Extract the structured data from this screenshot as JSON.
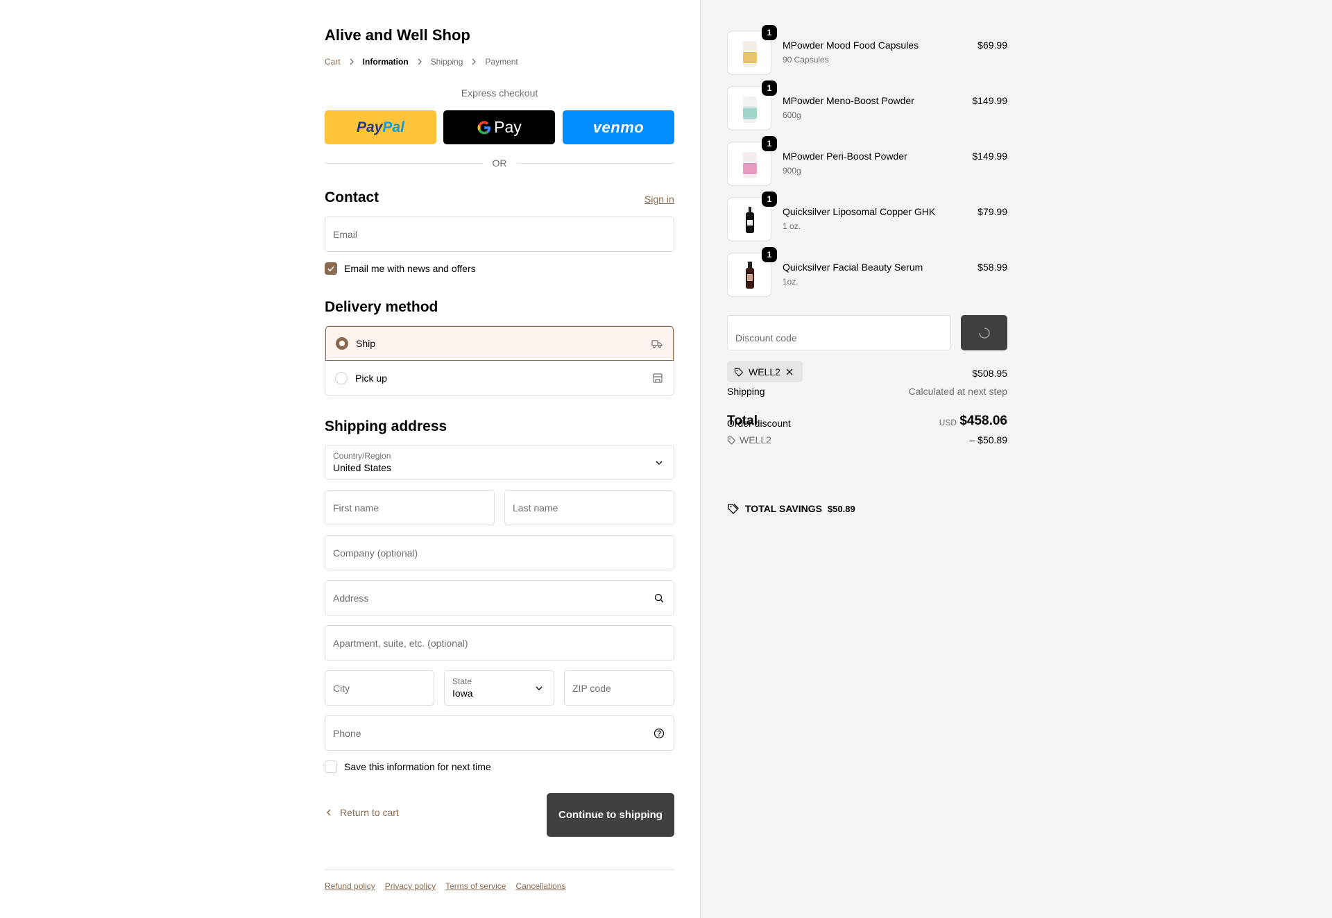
{
  "shop": {
    "title": "Alive and Well Shop"
  },
  "breadcrumb": {
    "cart": "Cart",
    "information": "Information",
    "shipping": "Shipping",
    "payment": "Payment"
  },
  "express": {
    "label": "Express checkout",
    "or": "OR",
    "gpay_label": "Pay",
    "venmo_label": "venmo"
  },
  "contact": {
    "heading": "Contact",
    "sign_in": "Sign in",
    "email_placeholder": "Email",
    "news_label": "Email me with news and offers",
    "news_checked": true
  },
  "delivery": {
    "heading": "Delivery method",
    "options": [
      {
        "label": "Ship",
        "selected": true,
        "icon": "truck-icon"
      },
      {
        "label": "Pick up",
        "selected": false,
        "icon": "store-icon"
      }
    ]
  },
  "shipping_address": {
    "heading": "Shipping address",
    "country_label": "Country/Region",
    "country_value": "United States",
    "first_name_placeholder": "First name",
    "last_name_placeholder": "Last name",
    "company_placeholder": "Company (optional)",
    "address_placeholder": "Address",
    "apartment_placeholder": "Apartment, suite, etc. (optional)",
    "city_placeholder": "City",
    "state_label": "State",
    "state_value": "Iowa",
    "zip_placeholder": "ZIP code",
    "phone_placeholder": "Phone",
    "save_label": "Save this information for next time"
  },
  "actions": {
    "return_to_cart": "Return to cart",
    "continue": "Continue to shipping"
  },
  "footer": {
    "links": [
      "Refund policy",
      "Privacy policy",
      "Terms of service",
      "Cancellations"
    ]
  },
  "summary": {
    "items": [
      {
        "name": "MPowder Mood Food Capsules",
        "variant": "90 Capsules",
        "price": "$69.99",
        "qty": "1",
        "color": "#e8c46a"
      },
      {
        "name": "MPowder Meno-Boost Powder",
        "variant": "600g",
        "price": "$149.99",
        "qty": "1",
        "color": "#9fd6c8"
      },
      {
        "name": "MPowder Peri-Boost Powder",
        "variant": "900g",
        "price": "$149.99",
        "qty": "1",
        "color": "#e59ac0"
      },
      {
        "name": "Quicksilver Liposomal Copper GHK",
        "variant": "1 oz.",
        "price": "$79.99",
        "qty": "1",
        "color": "#111111"
      },
      {
        "name": "Quicksilver Facial Beauty Serum",
        "variant": "1oz.",
        "price": "$58.99",
        "qty": "1",
        "color": "#3a1a14"
      }
    ],
    "discount_placeholder": "Discount code",
    "applied_code": "WELL2",
    "subtotal_value": "$508.95",
    "shipping_label": "Shipping",
    "shipping_value": "Calculated at next step",
    "total_label": "Total",
    "currency": "USD",
    "total_value": "$458.06",
    "order_discount_label": "Order discount",
    "discount_code": "WELL2",
    "discount_value": "– $50.89",
    "savings_label": "TOTAL SAVINGS",
    "savings_value": "$50.89"
  },
  "colors": {
    "accent": "#8b6a4f",
    "button_dark": "#404040",
    "paypal": "#ffc439",
    "venmo": "#008cff"
  }
}
